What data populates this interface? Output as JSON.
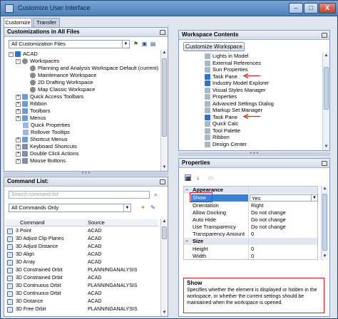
{
  "window": {
    "title": "Customize User Interface",
    "min": "–",
    "max": "□",
    "close": "X"
  },
  "tabs": [
    {
      "label": "Customize"
    },
    {
      "label": "Transfer"
    }
  ],
  "customizations": {
    "header": "Customizations in All Files",
    "filter_value": "All Customization Files",
    "tree": [
      {
        "label": "ACAD"
      },
      {
        "label": "Workspaces"
      },
      {
        "label": "Planning and Analysis Workspace Default (current)"
      },
      {
        "label": "Maintenance Workspace"
      },
      {
        "label": "2D Drafting Workspace"
      },
      {
        "label": "Map Classic Workspace"
      },
      {
        "label": "Quick Access Toolbars"
      },
      {
        "label": "Ribbon"
      },
      {
        "label": "Toolbars"
      },
      {
        "label": "Menus"
      },
      {
        "label": "Quick Properties"
      },
      {
        "label": "Rollover Tooltips"
      },
      {
        "label": "Shortcut Menus"
      },
      {
        "label": "Keyboard Shortcuts"
      },
      {
        "label": "Double Click Actions"
      },
      {
        "label": "Mouse Buttons"
      }
    ]
  },
  "command_list": {
    "header": "Command List:",
    "search_placeholder": "Search command list",
    "filter_value": "All Commands Only",
    "columns": [
      "Command",
      "Source"
    ],
    "rows": [
      {
        "command": "3 Point",
        "source": "ACAD"
      },
      {
        "command": "3D Adjust Clip Planes",
        "source": "ACAD"
      },
      {
        "command": "3D Adjust Distance",
        "source": "ACAD"
      },
      {
        "command": "3D Align",
        "source": "ACAD"
      },
      {
        "command": "3D Array",
        "source": "ACAD"
      },
      {
        "command": "3D Constrained Orbit",
        "source": "PLANNINGANALYSIS"
      },
      {
        "command": "3D Constrained Orbit",
        "source": "ACAD"
      },
      {
        "command": "3D Continuous Orbit",
        "source": "PLANNINGANALYSIS"
      },
      {
        "command": "3D Continuous Orbit",
        "source": "ACAD"
      },
      {
        "command": "3D Distance",
        "source": "ACAD"
      },
      {
        "command": "3D Free Orbit",
        "source": "PLANNINGANALYSIS"
      }
    ]
  },
  "workspace_contents": {
    "header": "Workspace Contents",
    "button_label": "Customize Workspace",
    "items": [
      {
        "label": "Lights in Model"
      },
      {
        "label": "External References"
      },
      {
        "label": "Sun Properties"
      },
      {
        "label": "Task Pane"
      },
      {
        "label": "Industry Model Explorer"
      },
      {
        "label": "Visual Styles Manager"
      },
      {
        "label": "Properties"
      },
      {
        "label": "Advanced Settings Dialog"
      },
      {
        "label": "Markup Set Manager"
      },
      {
        "label": "Task Pane"
      },
      {
        "label": "Quick Calc"
      },
      {
        "label": "Tool Palette"
      },
      {
        "label": "Ribbon"
      },
      {
        "label": "Design Center"
      }
    ]
  },
  "properties": {
    "header": "Properties",
    "categories": [
      {
        "label": "Appearance"
      },
      {
        "label": "Size"
      }
    ],
    "appearance_rows": [
      {
        "name": "Show",
        "value": "Yes"
      },
      {
        "name": "Orientation",
        "value": "Right"
      },
      {
        "name": "Allow Docking",
        "value": "Do not change"
      },
      {
        "name": "Auto Hide",
        "value": "Do not change"
      },
      {
        "name": "Use Transparency",
        "value": "Do not change"
      },
      {
        "name": "Transparency Amount",
        "value": "0"
      }
    ],
    "size_rows": [
      {
        "name": "Height",
        "value": "0"
      },
      {
        "name": "Width",
        "value": "0"
      }
    ],
    "description_title": "Show",
    "description_text": "Specifies whether the element is displayed or hidden in the workspace, or whether the current settings should be maintained when the workspace is opened."
  },
  "colors": {
    "highlight_red": "#e0201e",
    "selected_blue": "#3b7fd6",
    "title_bar": "#4d7fb8"
  },
  "icons": [
    "app-icon",
    "filter-icon",
    "save-icon",
    "load-icon",
    "workspace-icon",
    "search-icon",
    "star-icon",
    "arrow-icon"
  ]
}
